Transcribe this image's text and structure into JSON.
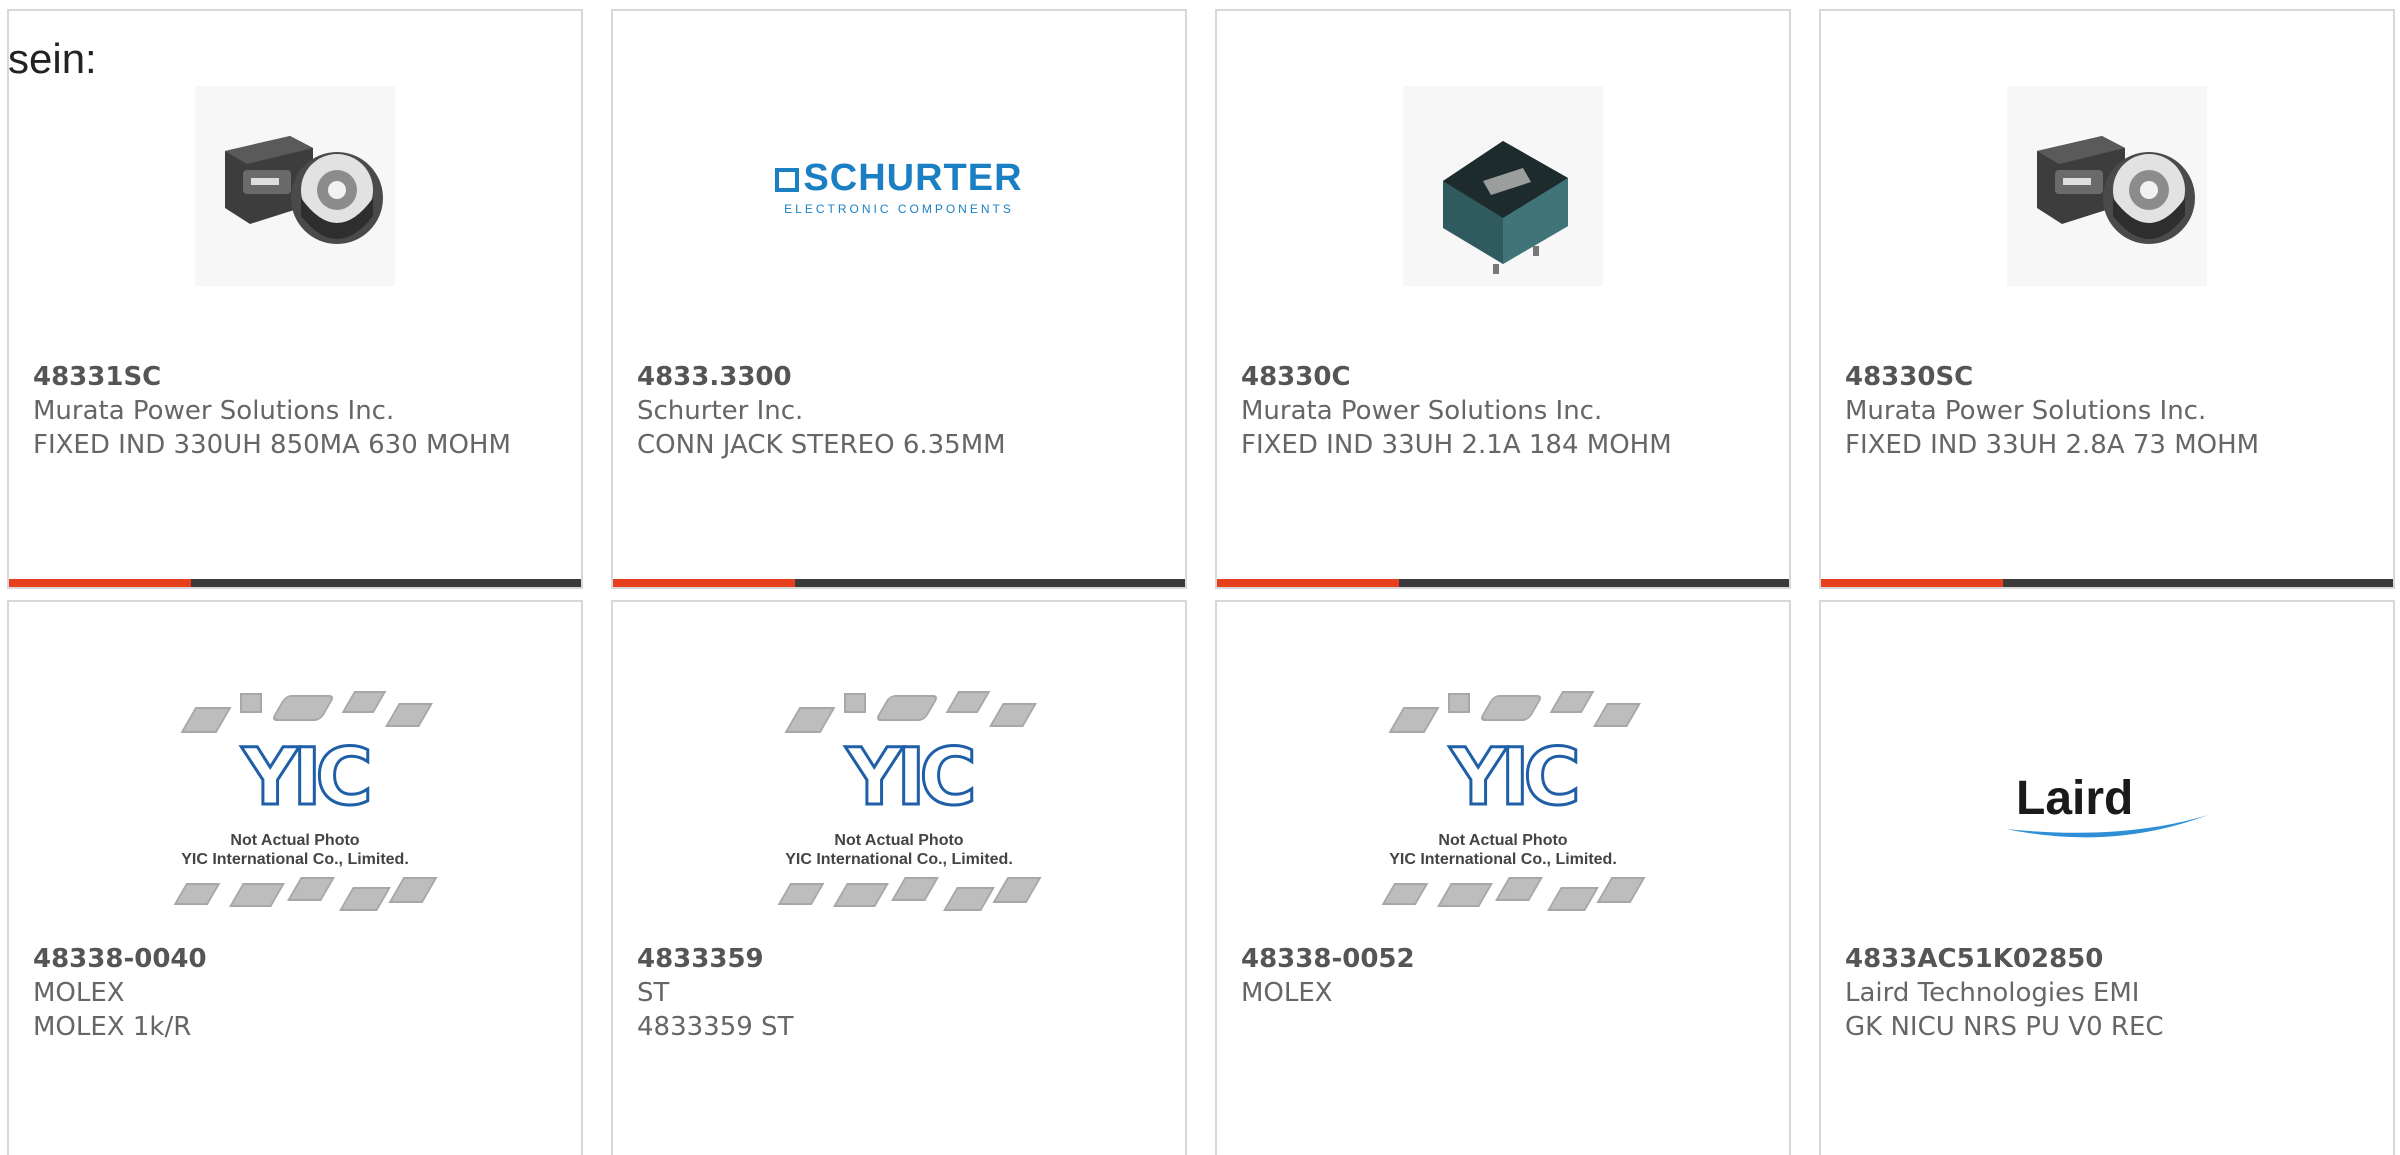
{
  "intro_text": "sein:",
  "products": [
    {
      "part": "48331SC",
      "maker": "Murata Power Solutions Inc.",
      "desc": "FIXED IND 330UH 850MA 630 MOHM",
      "image": "inductor-photo"
    },
    {
      "part": "4833.3300",
      "maker": "Schurter Inc.",
      "desc": "CONN JACK STEREO 6.35MM",
      "image": "schurter-logo"
    },
    {
      "part": "48330C",
      "maker": "Murata Power Solutions Inc.",
      "desc": "FIXED IND 33UH 2.1A 184 MOHM",
      "image": "shielded-inductor-photo"
    },
    {
      "part": "48330SC",
      "maker": "Murata Power Solutions Inc.",
      "desc": "FIXED IND 33UH 2.8A 73 MOHM",
      "image": "inductor-photo"
    },
    {
      "part": "48338-0040",
      "maker": "MOLEX",
      "desc": "MOLEX 1k/R",
      "image": "yic-placeholder"
    },
    {
      "part": "4833359",
      "maker": "ST",
      "desc": "4833359 ST",
      "image": "yic-placeholder"
    },
    {
      "part": "48338-0052",
      "maker": "MOLEX",
      "desc": "",
      "image": "yic-placeholder"
    },
    {
      "part": "4833AC51K02850",
      "maker": "Laird Technologies EMI",
      "desc": "GK NICU NRS PU V0 REC",
      "image": "laird-logo"
    }
  ],
  "placeholder": {
    "logo_text": "YIC",
    "caption_line1": "Not Actual Photo",
    "caption_line2": "YIC International Co., Limited."
  },
  "logos": {
    "schurter_name": "SCHURTER",
    "schurter_sub": "ELECTRONIC COMPONENTS",
    "laird_name": "Laird"
  },
  "colors": {
    "accent": "#e8401c",
    "bar": "#3a3a3a",
    "border": "#d8d8d8",
    "schurter_blue": "#1b7fc4",
    "yic_blue": "#1f5fa8"
  }
}
